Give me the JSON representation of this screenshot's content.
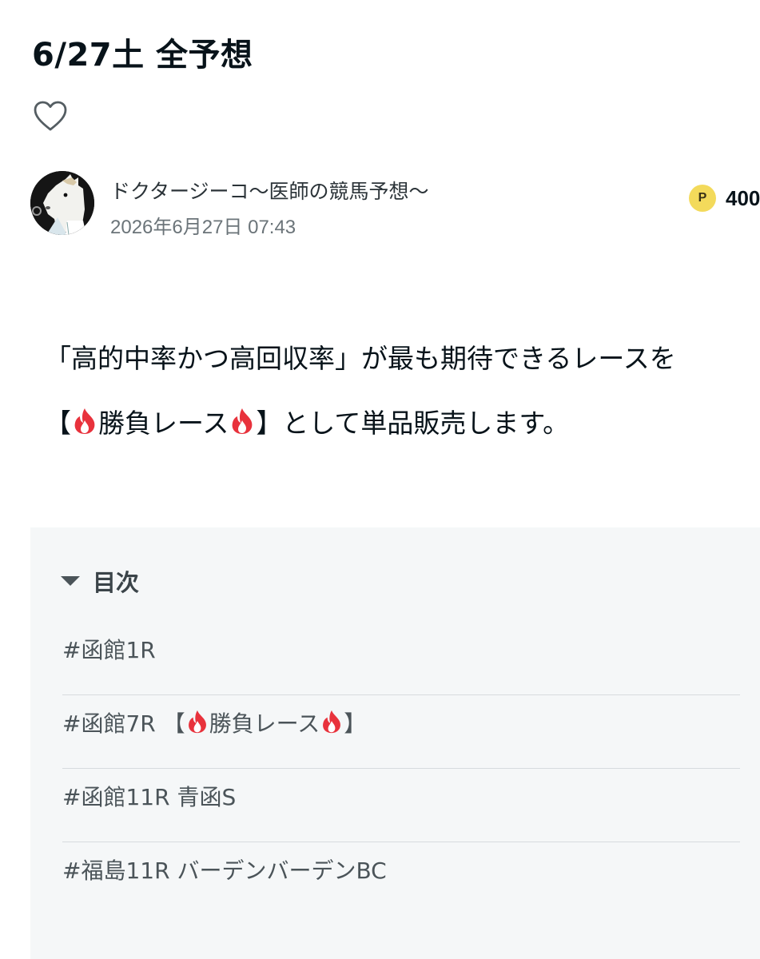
{
  "article": {
    "title": "6/27土 全予想",
    "like_icon": "heart-outline-icon"
  },
  "author": {
    "name": "ドクタージーコ〜医師の競馬予想〜",
    "date": "2026年6月27日 07:43",
    "avatar_icon": "horse-doctor-avatar"
  },
  "points": {
    "badge": "P",
    "value": "400"
  },
  "intro": {
    "line1": "「高的中率かつ高回収率」が最も期待できるレースを",
    "line2_open": "【",
    "line2_label": "勝負レース",
    "line2_close": "】として単品販売します。",
    "emoji_icon": "fire-icon",
    "emoji_color": "#e8323c"
  },
  "toc": {
    "title": "目次",
    "items": [
      {
        "text": "#函館1R"
      },
      {
        "prefix": "#函館7R 【",
        "label": "勝負レース",
        "suffix": "】"
      },
      {
        "text": "#函館11R 青函S"
      },
      {
        "text": "#福島11R バーデンバーデンBC"
      }
    ]
  }
}
